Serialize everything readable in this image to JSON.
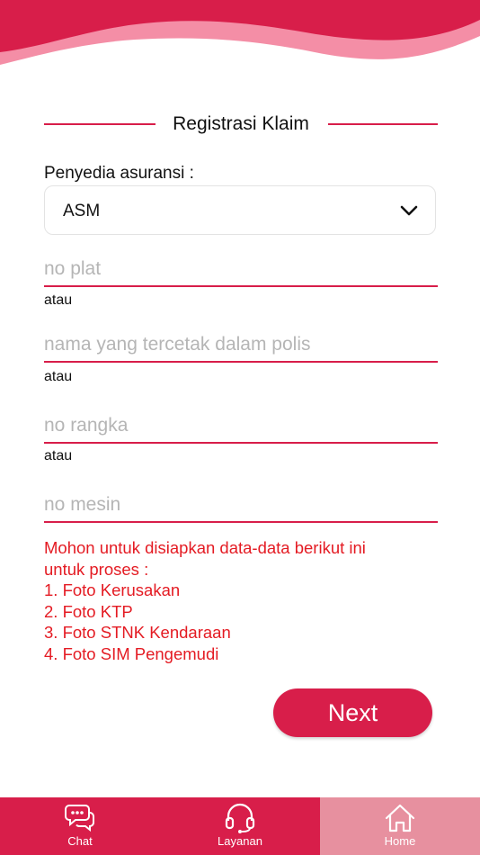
{
  "header": {
    "colors": {
      "wave_dark": "#d81e4a",
      "wave_light": "#f48ea6"
    }
  },
  "form": {
    "section_title": "Registrasi Klaim",
    "provider_label": "Penyedia asuransi :",
    "provider_selected": "ASM",
    "fields": [
      {
        "placeholder": "no plat"
      },
      {
        "placeholder": "nama yang tercetak dalam polis"
      },
      {
        "placeholder": "no rangka"
      },
      {
        "placeholder": "no mesin"
      }
    ],
    "or_labels": [
      "atau",
      "atau",
      "atau"
    ],
    "notes": [
      "Mohon untuk disiapkan data-data berikut ini",
      "untuk proses :",
      "1. Foto Kerusakan",
      "2. Foto KTP",
      "3. Foto STNK Kendaraan",
      "4. Foto SIM Pengemudi"
    ],
    "next_label": "Next"
  },
  "nav": {
    "items": [
      {
        "label": "Chat",
        "icon": "chat-bubbles-icon"
      },
      {
        "label": "Layanan",
        "icon": "headset-icon"
      },
      {
        "label": "Home",
        "icon": "home-icon",
        "active": true
      }
    ]
  },
  "colors": {
    "accent": "#d81e4a",
    "note_text": "#e41b23",
    "nav_active": "#e7909f"
  }
}
